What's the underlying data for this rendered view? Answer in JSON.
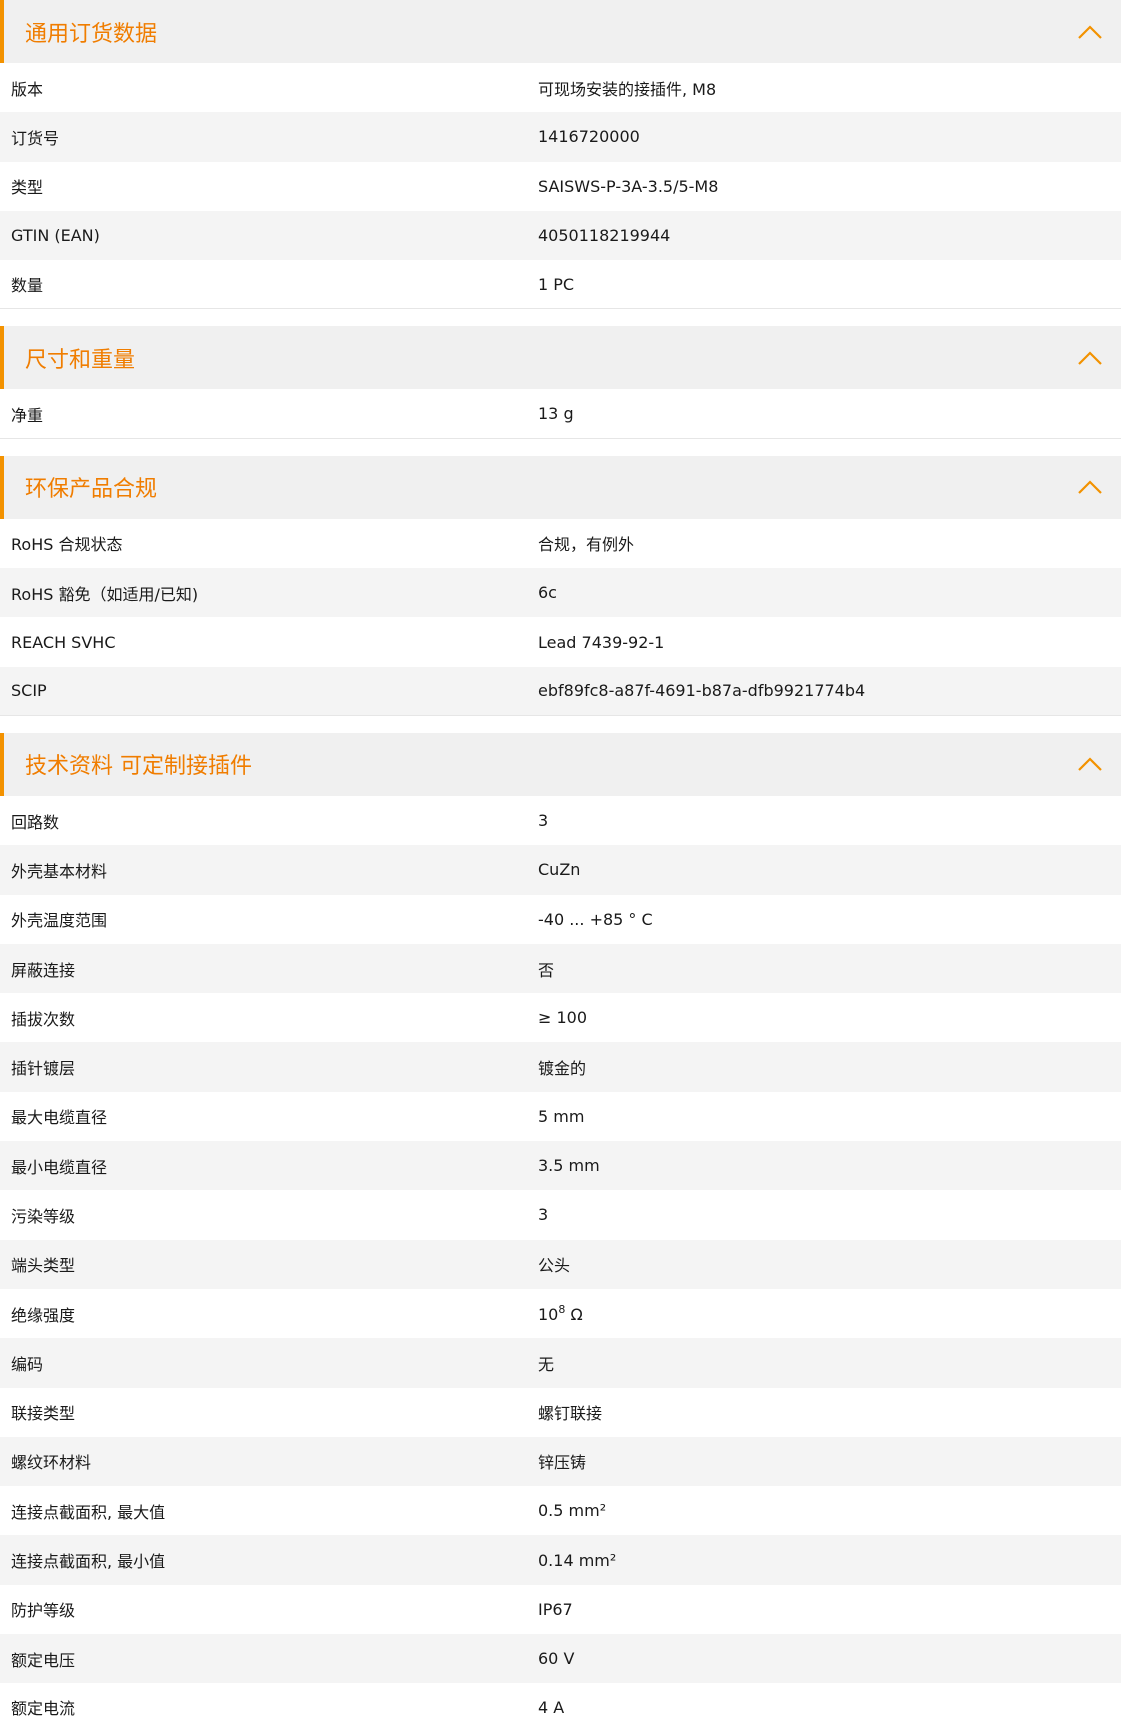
{
  "colors": {
    "accent": "#f39200",
    "title": "#f07d00",
    "header_bg": "#f0f0f0",
    "row_alt": "#f4f4f4"
  },
  "icons": {
    "collapse": "chevron-up-icon"
  },
  "sections": [
    {
      "title": "通用订货数据",
      "rows": [
        {
          "label": "版本",
          "value": "可现场安装的接插件, M8"
        },
        {
          "label": "订货号",
          "value": "1416720000"
        },
        {
          "label": "类型",
          "value": "SAISWS-P-3A-3.5/5-M8"
        },
        {
          "label": "GTIN (EAN)",
          "value": "4050118219944"
        },
        {
          "label": "数量",
          "value": "1  PC"
        }
      ]
    },
    {
      "title": "尺寸和重量",
      "rows": [
        {
          "label": "净重",
          "value": "13  g"
        }
      ]
    },
    {
      "title": "环保产品合规",
      "rows": [
        {
          "label": "RoHS 合规状态",
          "value": "合规，有例外"
        },
        {
          "label": "RoHS 豁免（如适用/已知)",
          "value": "6c"
        },
        {
          "label": "REACH SVHC",
          "value": "Lead 7439-92-1"
        },
        {
          "label": "SCIP",
          "value": "ebf89fc8-a87f-4691-b87a-dfb9921774b4"
        }
      ]
    },
    {
      "title": "技术资料 可定制接插件",
      "rows": [
        {
          "label": "回路数",
          "value": "3"
        },
        {
          "label": "外壳基本材料",
          "value": "CuZn"
        },
        {
          "label": "外壳温度范围",
          "value": "-40 ... +85 ° C"
        },
        {
          "label": "屏蔽连接",
          "value": "否"
        },
        {
          "label": "插拔次数",
          "value": "≥ 100"
        },
        {
          "label": "插针镀层",
          "value": "镀金的"
        },
        {
          "label": "最大电缆直径",
          "value": "5  mm"
        },
        {
          "label": "最小电缆直径",
          "value": "3.5  mm"
        },
        {
          "label": "污染等级",
          "value": "3"
        },
        {
          "label": "端头类型",
          "value": "公头"
        },
        {
          "label": "绝缘强度",
          "value": "10",
          "sup": "8",
          "suffix": " Ω"
        },
        {
          "label": "编码",
          "value": "无"
        },
        {
          "label": "联接类型",
          "value": "螺钉联接"
        },
        {
          "label": "螺纹环材料",
          "value": "锌压铸"
        },
        {
          "label": "连接点截面积, 最大值",
          "value": "0.5  mm²"
        },
        {
          "label": "连接点截面积, 最小值",
          "value": "0.14  mm²"
        },
        {
          "label": "防护等级",
          "value": "IP67"
        },
        {
          "label": "额定电压",
          "value": "60  V"
        },
        {
          "label": "额定电流",
          "value": "4  A"
        }
      ]
    }
  ]
}
